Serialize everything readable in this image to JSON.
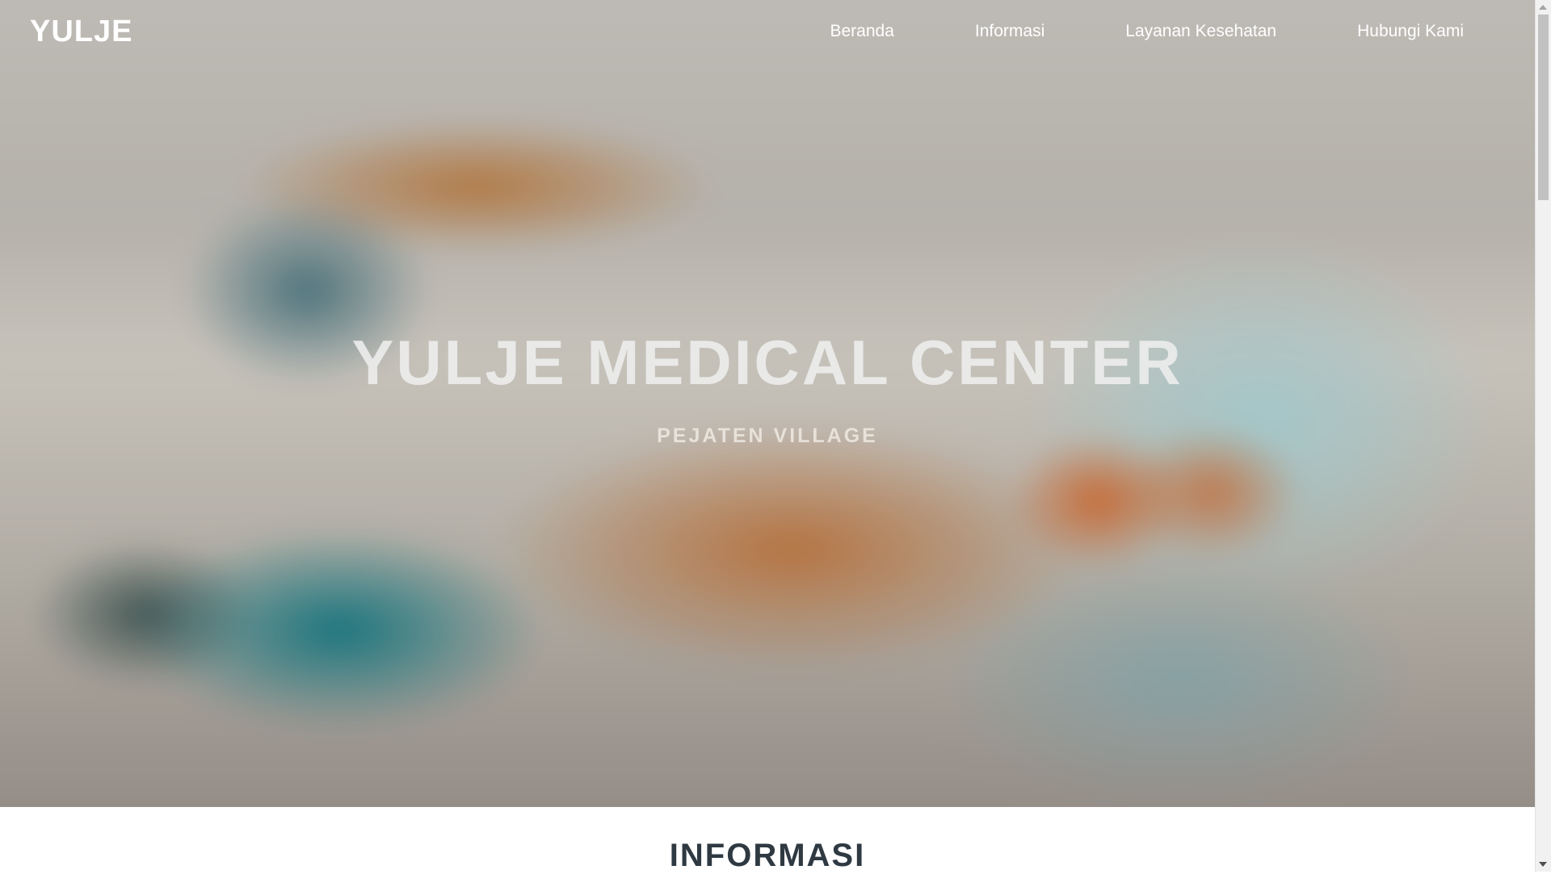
{
  "nav": {
    "brand": "YULJE",
    "links": [
      {
        "label": "Beranda"
      },
      {
        "label": "Informasi"
      },
      {
        "label": "Layanan Kesehatan"
      },
      {
        "label": "Hubungi Kami"
      }
    ]
  },
  "hero": {
    "title": "YULJE MEDICAL CENTER",
    "subtitle": "PEJATEN VILLAGE"
  },
  "sections": {
    "informasi_heading": "INFORMASI"
  },
  "colors": {
    "nav_text": "#ffffff",
    "heading_text": "#2f3942"
  }
}
